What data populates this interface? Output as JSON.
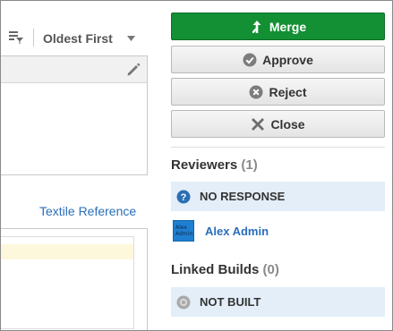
{
  "sort": {
    "label": "Oldest First"
  },
  "links": {
    "textile_reference": "Textile Reference"
  },
  "actions": {
    "merge": "Merge",
    "approve": "Approve",
    "reject": "Reject",
    "close": "Close"
  },
  "reviewers": {
    "title": "Reviewers",
    "count": "(1)",
    "status": "NO RESPONSE",
    "list": [
      {
        "name": "Alex Admin",
        "avatar_text": [
          "Alex",
          "Admin"
        ]
      }
    ]
  },
  "linked_builds": {
    "title": "Linked Builds",
    "count": "(0)",
    "status": "NOT BUILT"
  },
  "colors": {
    "merge_green": "#138f34",
    "link_blue": "#2a6ebb",
    "status_bg": "#e3eef8",
    "help_icon_blue": "#2a6fb5"
  }
}
